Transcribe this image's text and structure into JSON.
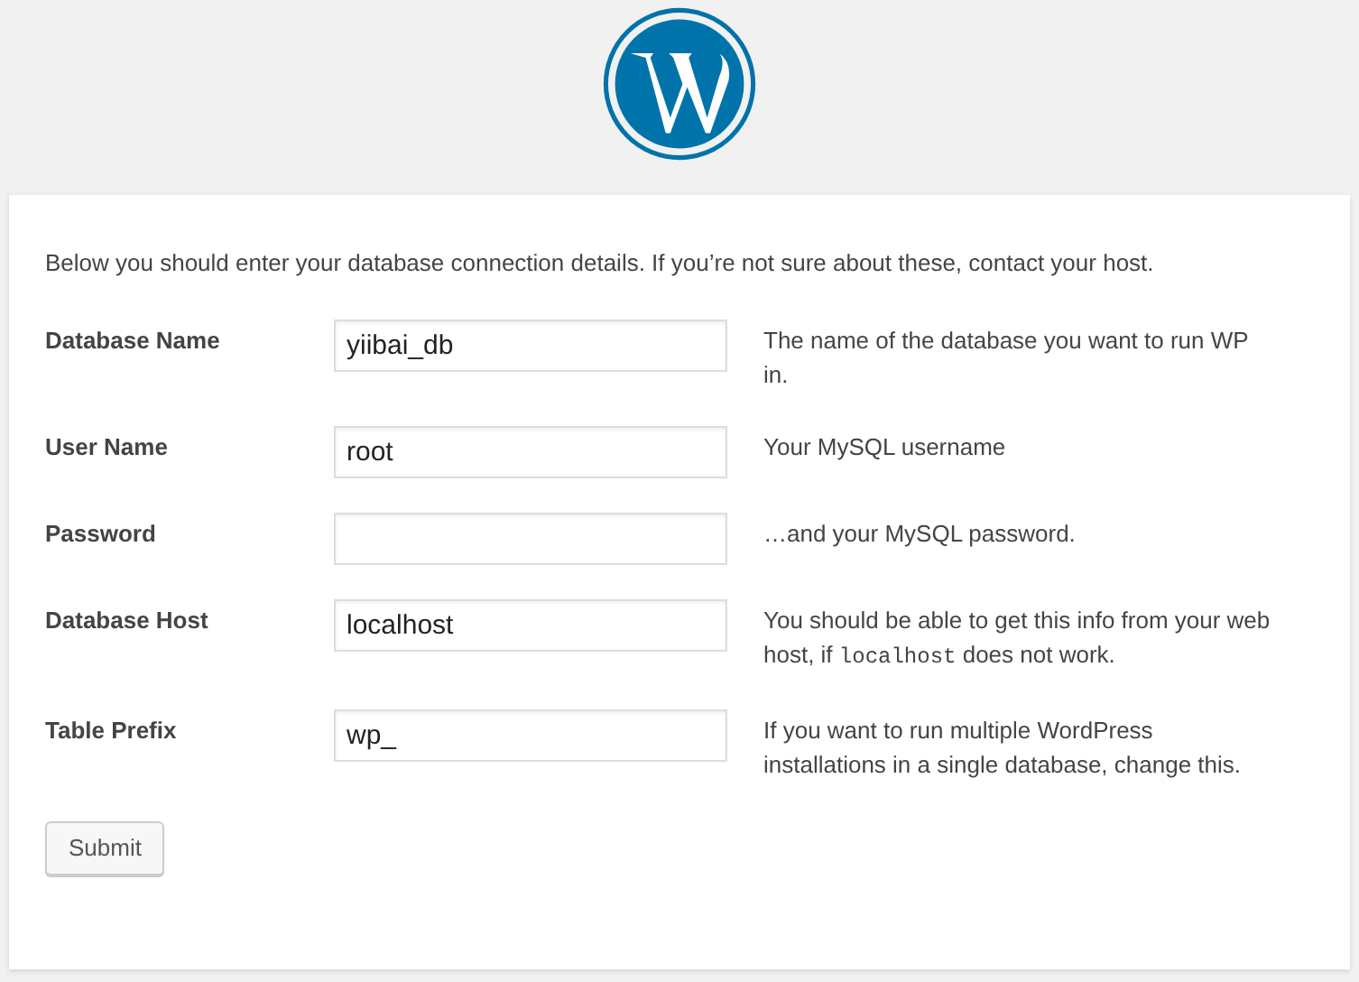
{
  "intro": "Below you should enter your database connection details. If you’re not sure about these, contact your host.",
  "fields": [
    {
      "label": "Database Name",
      "value": "yiibai_db",
      "help": [
        {
          "kind": "text",
          "text": "The name of the database you want to run WP in."
        }
      ]
    },
    {
      "label": "User Name",
      "value": "root",
      "help": [
        {
          "kind": "text",
          "text": "Your MySQL username"
        }
      ]
    },
    {
      "label": "Password",
      "help": [
        {
          "kind": "text",
          "text": "…and your MySQL password."
        }
      ]
    },
    {
      "label": "Database Host",
      "value": "localhost",
      "help": [
        {
          "kind": "text",
          "text": "You should be able to get this info from your web host, if "
        },
        {
          "kind": "code",
          "text": "localhost"
        },
        {
          "kind": "text",
          "text": " does not work."
        }
      ]
    },
    {
      "label": "Table Prefix",
      "value": "wp_",
      "help": [
        {
          "kind": "text",
          "text": "If you want to run multiple WordPress installations in a single database, change this."
        }
      ]
    }
  ],
  "submit": "Submit"
}
